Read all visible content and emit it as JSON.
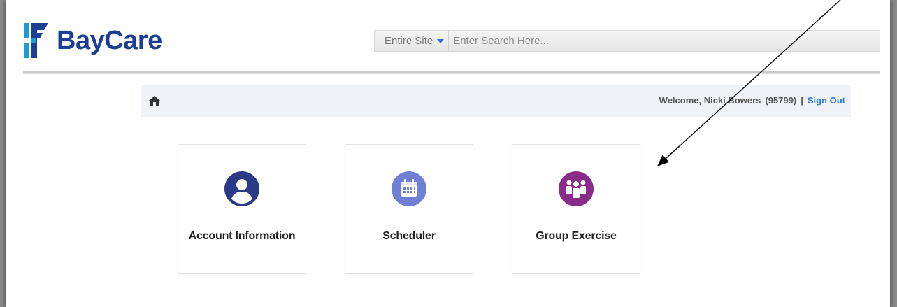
{
  "brand": {
    "name": "BayCare",
    "color": "#1c3f94",
    "accent": "#1a9ad6"
  },
  "search": {
    "scope": "Entire Site",
    "placeholder": "Enter Search Here..."
  },
  "welcome": {
    "greeting": "Welcome, Nicki Bowers",
    "member_id": "(95799)",
    "separator": "|",
    "sign_out": "Sign Out"
  },
  "tiles": [
    {
      "label": "Account Information",
      "icon": "user-circle-icon",
      "color": "#2a3a86"
    },
    {
      "label": "Scheduler",
      "icon": "calendar-icon",
      "color": "#6f7fd6"
    },
    {
      "label": "Group Exercise",
      "icon": "group-icon",
      "color": "#8a2b8a"
    }
  ],
  "icons": {
    "home": "home-icon",
    "scope_caret": "chevron-down-icon"
  }
}
